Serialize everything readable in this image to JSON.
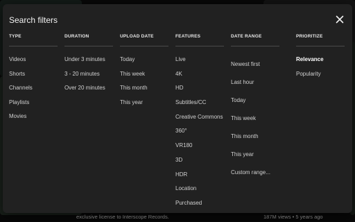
{
  "dialog": {
    "title": "Search filters",
    "close_icon": "close-icon"
  },
  "columns": [
    {
      "key": "type",
      "heading": "TYPE",
      "options": [
        "Videos",
        "Shorts",
        "Channels",
        "Playlists",
        "Movies"
      ]
    },
    {
      "key": "duration",
      "heading": "DURATION",
      "options": [
        "Under 3 minutes",
        "3 - 20 minutes",
        "Over 20 minutes"
      ]
    },
    {
      "key": "upload_date",
      "heading": "UPLOAD DATE",
      "options": [
        "Today",
        "This week",
        "This month",
        "This year"
      ]
    },
    {
      "key": "features",
      "heading": "FEATURES",
      "options": [
        "Live",
        "4K",
        "HD",
        "Subtitles/CC",
        "Creative Commons",
        "360°",
        "VR180",
        "3D",
        "HDR",
        "Location",
        "Purchased"
      ]
    },
    {
      "key": "date_range",
      "heading": "DATE RANGE",
      "options": [
        "Newest first",
        "Last hour",
        "Today",
        "This week",
        "This month",
        "This year",
        "Custom range..."
      ]
    },
    {
      "key": "prioritize",
      "heading": "PRIORITIZE",
      "options": [
        "Relevance",
        "Popularity"
      ],
      "selected": "Relevance"
    }
  ],
  "background": {
    "footer_left": "exclusive license to Interscope Records.",
    "footer_right": "187M views • 5 years ago"
  },
  "colors": {
    "dialog_bg": "#212121",
    "text": "#f1f1f1",
    "muted": "#d0d0d0",
    "rule": "#4a4a4a"
  }
}
